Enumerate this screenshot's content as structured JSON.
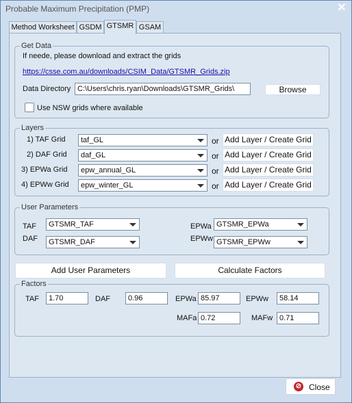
{
  "window": {
    "title": "Probable Maximum Precipitation (PMP)",
    "close_glyph": "✕"
  },
  "tabs": [
    {
      "label": "Method Worksheet"
    },
    {
      "label": "GSDM"
    },
    {
      "label": "GTSMR",
      "active": true
    },
    {
      "label": "GSAM"
    }
  ],
  "get_data": {
    "label": "Get Data",
    "instruction": "If neede, please download and extract the grids",
    "link": "https://csse.com.au/downloads/CSIM_Data/GTSMR_Grids.zip",
    "directory_label": "Data Directory",
    "directory_value": "C:\\Users\\chris.ryan\\Downloads\\GTSMR_Grids\\",
    "browse_label": "Browse",
    "nsw_label": "Use NSW grids where available",
    "nsw_checked": false
  },
  "layers": {
    "label": "Layers",
    "or_text": "or",
    "rows": [
      {
        "label": "1) TAF Grid",
        "value": "taf_GL",
        "button": "Add Layer / Create Grid"
      },
      {
        "label": "2) DAF Grid",
        "value": "daf_GL",
        "button": "Add Layer / Create Grid"
      },
      {
        "label": "3) EPWa Grid",
        "value": "epw_annual_GL",
        "button": "Add Layer / Create Grid"
      },
      {
        "label": "4) EPWw Grid",
        "value": "epw_winter_GL",
        "button": "Add Layer / Create Grid"
      }
    ]
  },
  "user_parameters": {
    "label": "User Parameters",
    "taf_label": "TAF",
    "taf_value": "GTSMR_TAF",
    "daf_label": "DAF",
    "daf_value": "GTSMR_DAF",
    "epwa_label": "EPWa",
    "epwa_value": "GTSMR_EPWa",
    "epww_label": "EPWw",
    "epww_value": "GTSMR_EPWw"
  },
  "actions": {
    "add_user_parameters": "Add User Parameters",
    "calculate_factors": "Calculate Factors"
  },
  "factors": {
    "label": "Factors",
    "taf_label": "TAF",
    "taf_value": "1.70",
    "daf_label": "DAF",
    "daf_value": "0.96",
    "epwa_label": "EPWa",
    "epwa_value": "85.97",
    "epww_label": "EPWw",
    "epww_value": "58.14",
    "mafa_label": "MAFa",
    "mafa_value": "0.72",
    "mafw_label": "MAFw",
    "mafw_value": "0.71"
  },
  "footer": {
    "close_label": "Close",
    "close_icon": "cancel-icon"
  }
}
